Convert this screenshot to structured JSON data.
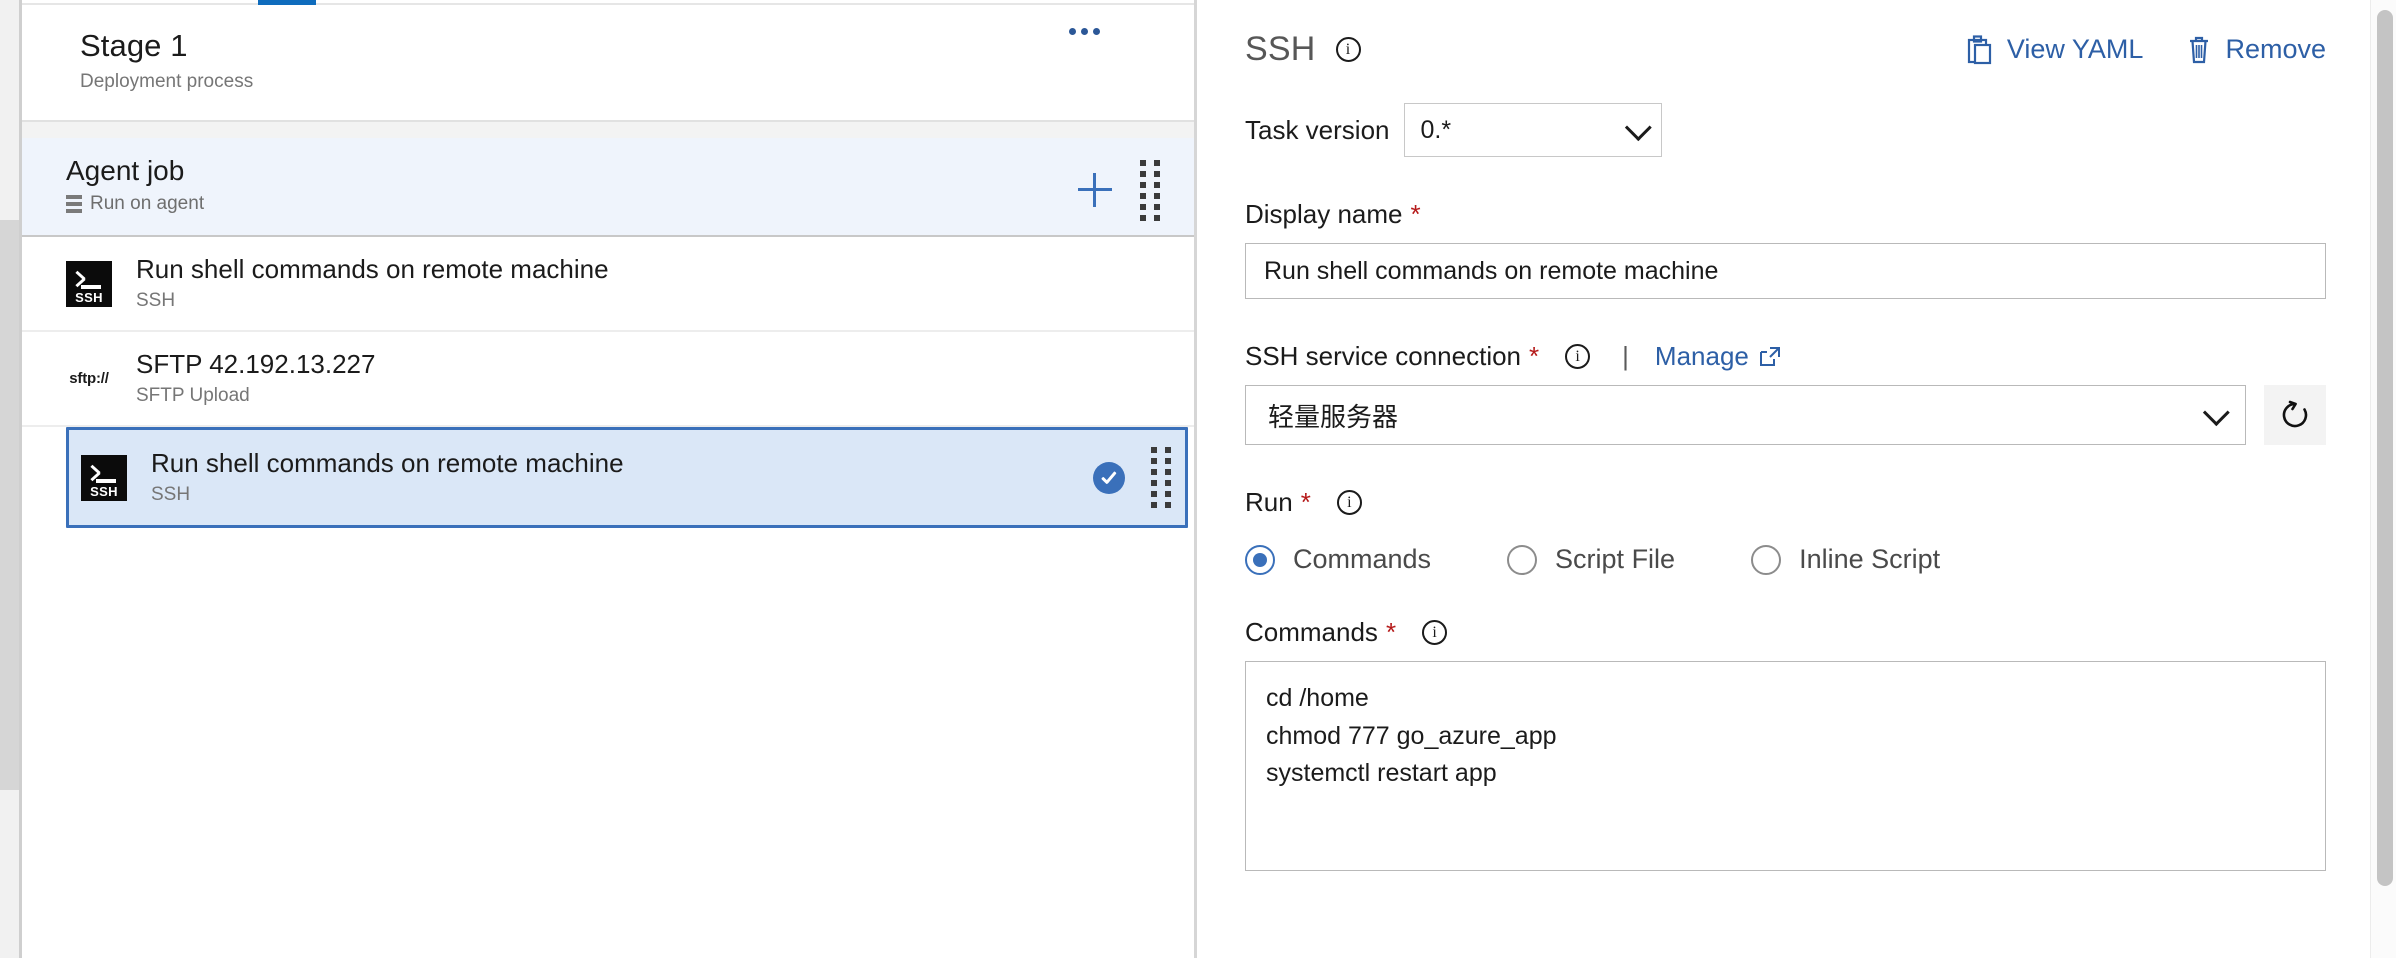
{
  "left_panel": {
    "stage": {
      "title": "Stage 1",
      "subtitle": "Deployment process",
      "overflow_menu_label": "..."
    },
    "agent_job": {
      "title": "Agent job",
      "subtitle": "Run on agent",
      "add_label": "+",
      "icon": "server-icon"
    },
    "tasks": [
      {
        "name": "Run shell commands on remote machine",
        "subtitle": "SSH",
        "icon": "ssh-icon",
        "icon_text": "SSH",
        "selected": false
      },
      {
        "name": "SFTP 42.192.13.227",
        "subtitle": "SFTP Upload",
        "icon": "sftp-icon",
        "icon_text": "sftp://",
        "selected": false
      },
      {
        "name": "Run shell commands on remote machine",
        "subtitle": "SSH",
        "icon": "ssh-icon",
        "icon_text": "SSH",
        "selected": true
      }
    ]
  },
  "right_panel": {
    "title": "SSH",
    "actions": {
      "view_yaml": "View YAML",
      "remove": "Remove"
    },
    "task_version": {
      "label": "Task version",
      "value": "0.*"
    },
    "display_name": {
      "label": "Display name",
      "required_marker": "*",
      "value": "Run shell commands on remote machine"
    },
    "ssh_service_connection": {
      "label": "SSH service connection",
      "required_marker": "*",
      "separator": "|",
      "manage_label": "Manage",
      "value": "轻量服务器",
      "refresh_label": "refresh"
    },
    "run": {
      "label": "Run",
      "required_marker": "*",
      "options": [
        {
          "label": "Commands",
          "selected": true
        },
        {
          "label": "Script File",
          "selected": false
        },
        {
          "label": "Inline Script",
          "selected": false
        }
      ]
    },
    "commands": {
      "label": "Commands",
      "required_marker": "*",
      "value": "cd /home\nchmod 777 go_azure_app\nsystemctl restart app"
    }
  },
  "colors": {
    "accent_blue": "#3a70ba",
    "link_blue": "#2d5fa6",
    "selected_row_bg": "#dae7f7",
    "agent_job_bg": "#eff4fc",
    "required_red": "#b51919"
  }
}
